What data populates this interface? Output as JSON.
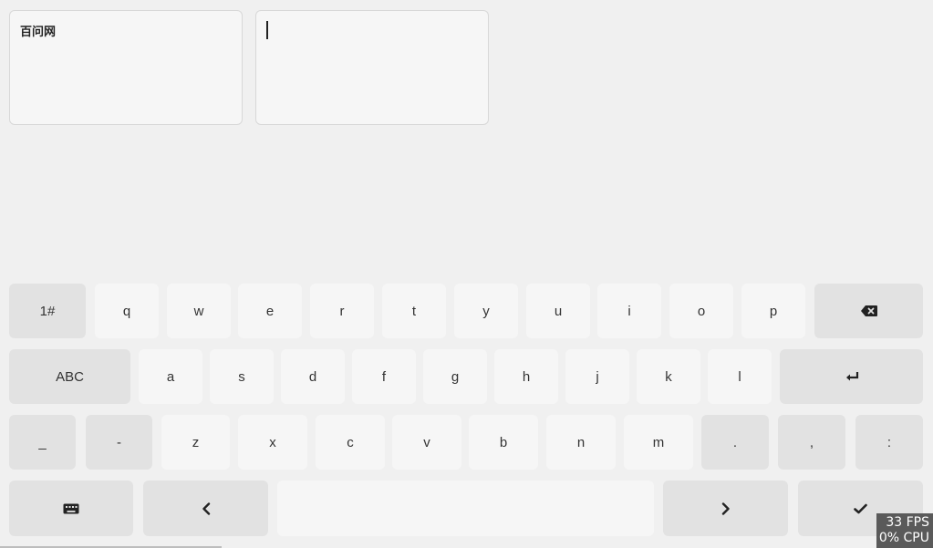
{
  "text_fields": {
    "left": {
      "value": "百问网"
    },
    "right": {
      "value": ""
    }
  },
  "keyboard": {
    "row1": {
      "mode_label": "1#",
      "keys": [
        "q",
        "w",
        "e",
        "r",
        "t",
        "y",
        "u",
        "i",
        "o",
        "p"
      ],
      "backspace_icon": "backspace-icon"
    },
    "row2": {
      "mode_label": "ABC",
      "keys": [
        "a",
        "s",
        "d",
        "f",
        "g",
        "h",
        "j",
        "k",
        "l"
      ],
      "enter_icon": "enter-icon"
    },
    "row3": {
      "left_func": [
        "_",
        "-"
      ],
      "keys": [
        "z",
        "x",
        "c",
        "v",
        "b",
        "n",
        "m"
      ],
      "right_func": [
        ".",
        ",",
        ":"
      ]
    },
    "row4": {
      "keyboard_icon": "keyboard-icon",
      "left_arrow_icon": "chevron-left-icon",
      "space_label": "",
      "right_arrow_icon": "chevron-right-icon",
      "ok_icon": "checkmark-icon"
    }
  },
  "perf_overlay": {
    "fps": "33 FPS",
    "cpu": "0% CPU"
  }
}
